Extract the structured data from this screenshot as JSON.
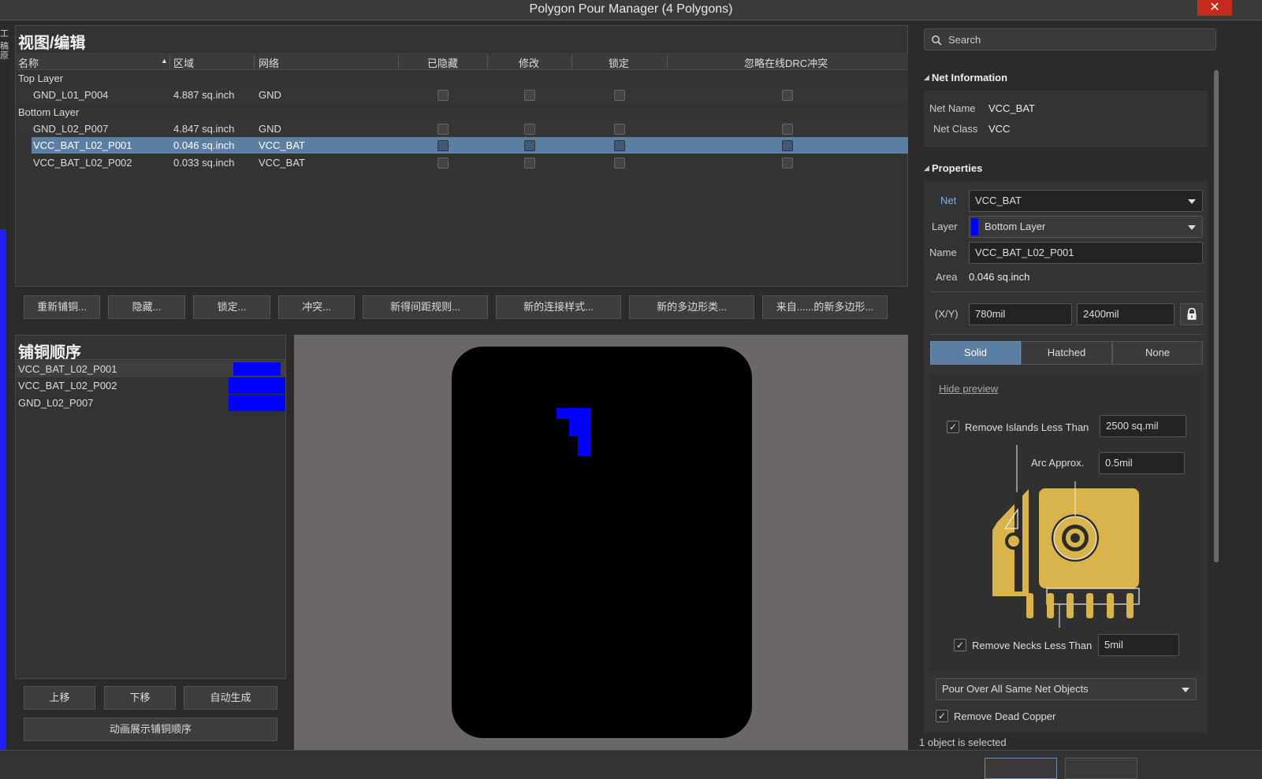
{
  "window": {
    "title": "Polygon Pour Manager (4 Polygons)",
    "close_glyph": "✕"
  },
  "view_edit": {
    "title": "视图/编辑",
    "headers": {
      "name": "名称",
      "area": "区域",
      "net": "网络",
      "hidden": "已隐藏",
      "modify": "修改",
      "locked": "锁定",
      "ignore_drc": "忽略在线DRC冲突"
    },
    "groups": [
      {
        "label": "Top Layer",
        "rows": [
          {
            "name": "GND_L01_P004",
            "area": "4.887 sq.inch",
            "net": "GND"
          }
        ]
      },
      {
        "label": "Bottom Layer",
        "rows": [
          {
            "name": "GND_L02_P007",
            "area": "4.847 sq.inch",
            "net": "GND"
          },
          {
            "name": "VCC_BAT_L02_P001",
            "area": "0.046 sq.inch",
            "net": "VCC_BAT"
          },
          {
            "name": "VCC_BAT_L02_P002",
            "area": "0.033 sq.inch",
            "net": "VCC_BAT"
          }
        ]
      }
    ],
    "buttons": [
      "重新铺铜...",
      "隐藏...",
      "锁定...",
      "冲突...",
      "新得间距规则...",
      "新的连接样式...",
      "新的多边形类...",
      "来自......的新多边形..."
    ]
  },
  "pour_order": {
    "title": "铺铜顺序",
    "items": [
      "VCC_BAT_L02_P001",
      "VCC_BAT_L02_P002",
      "GND_L02_P007"
    ],
    "swatch_color": "#0000ff",
    "buttons": {
      "up": "上移",
      "down": "下移",
      "auto": "自动生成",
      "animate": "动画展示铺铜顺序"
    }
  },
  "right_panel": {
    "search_placeholder": "Search",
    "net_info": {
      "title": "Net Information",
      "net_name_label": "Net Name",
      "net_name": "VCC_BAT",
      "net_class_label": "Net Class",
      "net_class": "VCC"
    },
    "properties": {
      "title": "Properties",
      "net_label": "Net",
      "net": "VCC_BAT",
      "layer_label": "Layer",
      "layer": "Bottom Layer",
      "layer_color": "#0000ff",
      "name_label": "Name",
      "name": "VCC_BAT_L02_P001",
      "area_label": "Area",
      "area": "0.046 sq.inch",
      "xy_label": "(X/Y)",
      "x": "780mil",
      "y": "2400mil"
    },
    "fill_modes": [
      "Solid",
      "Hatched",
      "None"
    ],
    "hide_preview": "Hide preview",
    "remove_islands_label": "Remove Islands Less Than",
    "remove_islands_value": "2500 sq.mil",
    "arc_approx_label": "Arc Approx.",
    "arc_approx_value": "0.5mil",
    "remove_necks_label": "Remove Necks Less Than",
    "remove_necks_value": "5mil",
    "pour_over": "Pour Over All Same Net Objects",
    "remove_dead_copper": "Remove Dead Copper",
    "check_glyph": "✓"
  },
  "status": "1 object is selected",
  "edge_text": [
    "工稿",
    "原"
  ],
  "colors": {
    "selection": "#5b7fa3",
    "copper_preview": "#0000ff",
    "diagram_gold": "#d9b44a"
  }
}
